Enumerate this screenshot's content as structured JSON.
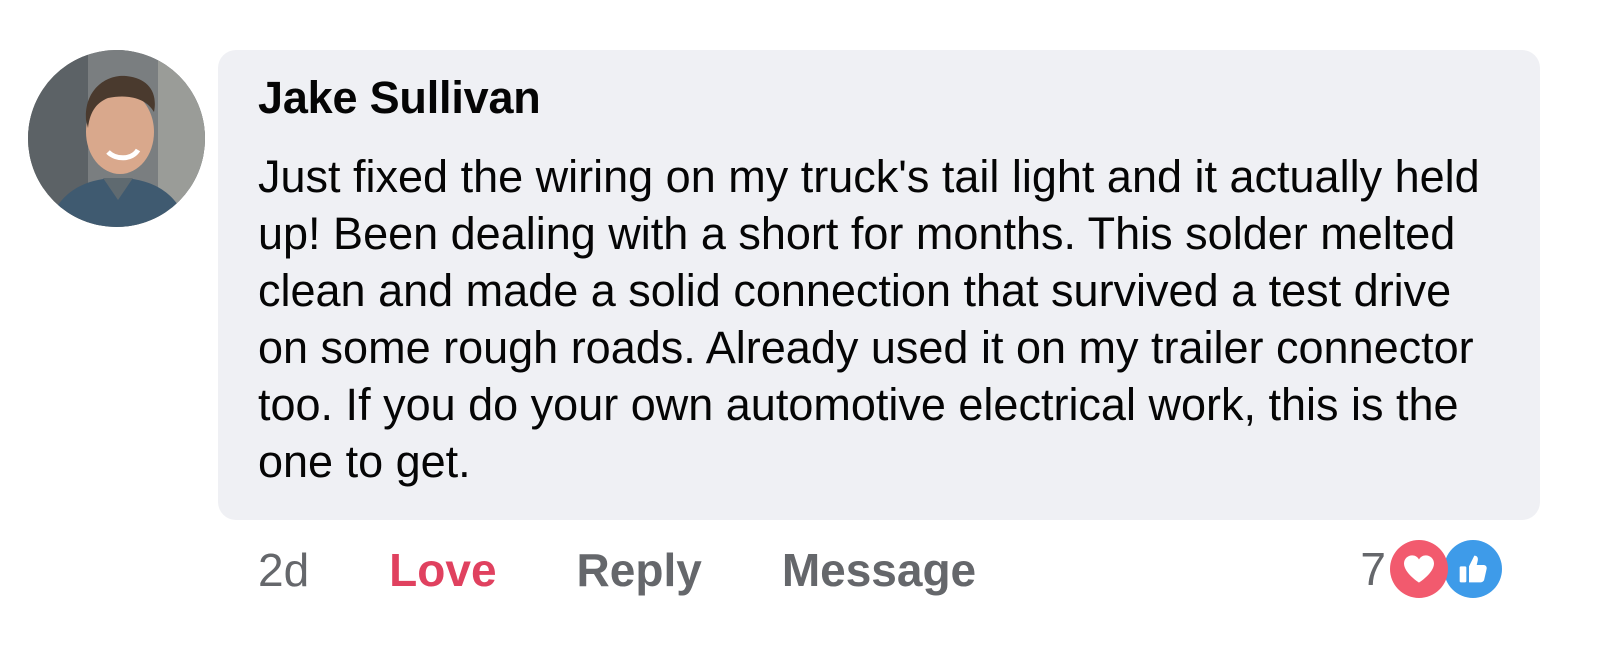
{
  "comment": {
    "author": "Jake Sullivan",
    "text": "Just fixed the wiring on my truck's tail light and it actually held up! Been dealing with a short for months. This solder melted clean and made a solid connection that survived a test drive on some rough roads. Already used it on my trailer connector too. If you do your own automotive electrical work, this is the one to get."
  },
  "actions": {
    "timestamp": "2d",
    "love_label": "Love",
    "reply_label": "Reply",
    "message_label": "Message"
  },
  "reactions": {
    "count": "7",
    "icons": [
      "heart-icon",
      "thumbs-up-icon"
    ],
    "colors": {
      "love": "#e0415f",
      "heart_badge": "#f25a6e",
      "like_badge": "#3e9be9"
    }
  }
}
